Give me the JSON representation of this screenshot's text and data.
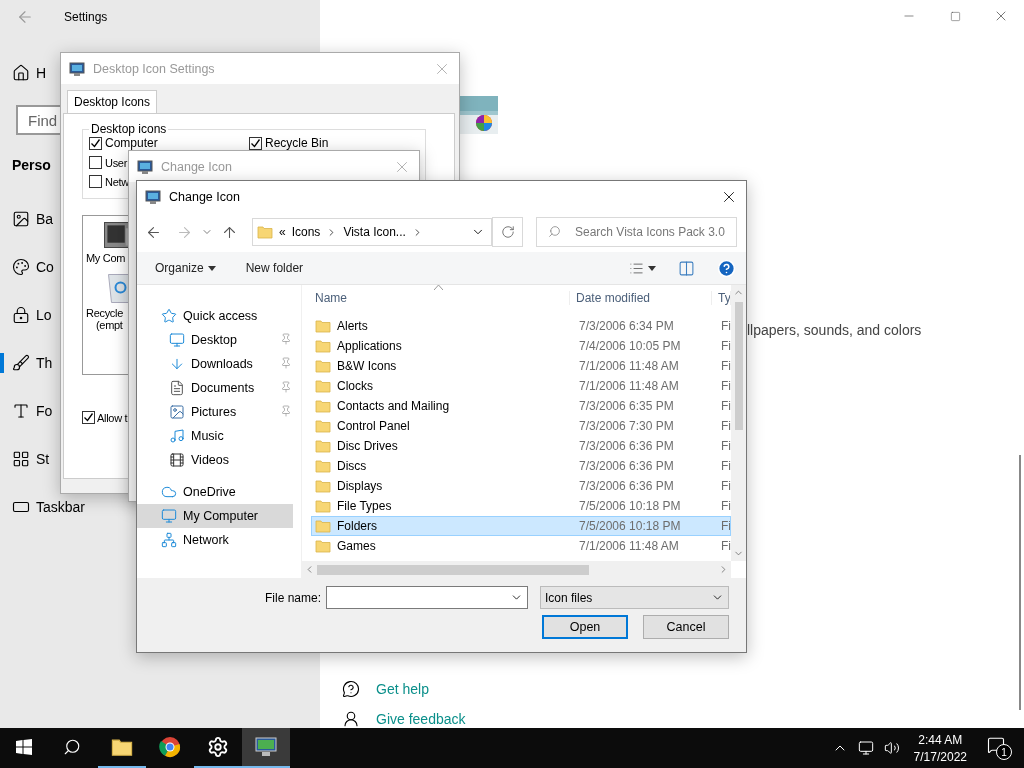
{
  "settings": {
    "title": "Settings",
    "home": "H",
    "search_placeholder": "Find",
    "section": "Perso",
    "nav": [
      {
        "label": "Ba",
        "selected": false
      },
      {
        "label": "Co",
        "selected": false
      },
      {
        "label": "Lo",
        "selected": false
      },
      {
        "label": "Th",
        "selected": true
      },
      {
        "label": "Fo",
        "selected": false
      },
      {
        "label": "St",
        "selected": false
      },
      {
        "label": "Taskbar",
        "selected": false
      }
    ],
    "content_text": "llpapers, sounds, and colors",
    "links": [
      "Get help",
      "Give feedback"
    ]
  },
  "desktop_icon_settings": {
    "title": "Desktop Icon Settings",
    "tab": "Desktop Icons",
    "group": "Desktop icons",
    "checkboxes": [
      {
        "label": "Computer",
        "checked": true
      },
      {
        "label": "Recycle Bin",
        "checked": true
      },
      {
        "label": "User",
        "checked": false
      },
      {
        "label": "Netw",
        "checked": false
      }
    ],
    "icons": [
      {
        "label": "My Com"
      },
      {
        "label": "Recycle",
        "sub": "(empt"
      }
    ],
    "allow": {
      "label": "Allow t",
      "checked": true
    }
  },
  "change_icon_back": {
    "title": "Change Icon"
  },
  "dialog": {
    "title": "Change Icon",
    "address": {
      "overflow": "«",
      "crumbs": [
        "Icons",
        "Vista Icon..."
      ]
    },
    "search_placeholder": "Search Vista Icons Pack 3.0",
    "toolbar": [
      {
        "label": "Organize",
        "menu": true
      },
      {
        "label": "New folder",
        "menu": false
      }
    ],
    "nav": [
      {
        "label": "Quick access",
        "selected": false,
        "children": [
          {
            "label": "Desktop",
            "pinned": true,
            "selected": false
          },
          {
            "label": "Downloads",
            "pinned": true,
            "selected": false
          },
          {
            "label": "Documents",
            "pinned": true,
            "selected": false
          },
          {
            "label": "Pictures",
            "pinned": true,
            "selected": false
          },
          {
            "label": "Music",
            "pinned": false,
            "selected": false
          },
          {
            "label": "Videos",
            "pinned": false,
            "selected": false
          }
        ]
      },
      {
        "label": "OneDrive",
        "selected": false
      },
      {
        "label": "My Computer",
        "selected": true
      },
      {
        "label": "Network",
        "selected": false
      }
    ],
    "columns": [
      "Name",
      "Date modified",
      "Ty"
    ],
    "rows": [
      {
        "name": "Alerts",
        "date": "7/3/2006 6:34 PM",
        "type": "Fi",
        "selected": false
      },
      {
        "name": "Applications",
        "date": "7/4/2006 10:05 PM",
        "type": "Fi",
        "selected": false
      },
      {
        "name": "B&W Icons",
        "date": "7/1/2006 11:48 AM",
        "type": "Fi",
        "selected": false
      },
      {
        "name": "Clocks",
        "date": "7/1/2006 11:48 AM",
        "type": "Fi",
        "selected": false
      },
      {
        "name": "Contacts and Mailing",
        "date": "7/3/2006 6:35 PM",
        "type": "Fi",
        "selected": false
      },
      {
        "name": "Control Panel",
        "date": "7/3/2006 7:30 PM",
        "type": "Fi",
        "selected": false
      },
      {
        "name": "Disc Drives",
        "date": "7/3/2006 6:36 PM",
        "type": "Fi",
        "selected": false
      },
      {
        "name": "Discs",
        "date": "7/3/2006 6:36 PM",
        "type": "Fi",
        "selected": false
      },
      {
        "name": "Displays",
        "date": "7/3/2006 6:36 PM",
        "type": "Fi",
        "selected": false
      },
      {
        "name": "File Types",
        "date": "7/5/2006 10:18 PM",
        "type": "Fi",
        "selected": false
      },
      {
        "name": "Folders",
        "date": "7/5/2006 10:18 PM",
        "type": "Fi",
        "selected": true
      },
      {
        "name": "Games",
        "date": "7/1/2006 11:48 AM",
        "type": "Fi",
        "selected": false
      }
    ],
    "file_name_label": "File name:",
    "file_type": "Icon files",
    "buttons": [
      {
        "label": "Open",
        "default": true
      },
      {
        "label": "Cancel",
        "default": false
      }
    ]
  },
  "taskbar": {
    "apps": [
      {
        "running": true,
        "active": false
      },
      {
        "running": false,
        "active": false
      },
      {
        "running": true,
        "active": false
      },
      {
        "running": true,
        "active": true
      }
    ],
    "time": "2:44 AM",
    "date": "7/17/2022",
    "notifications": "1"
  }
}
